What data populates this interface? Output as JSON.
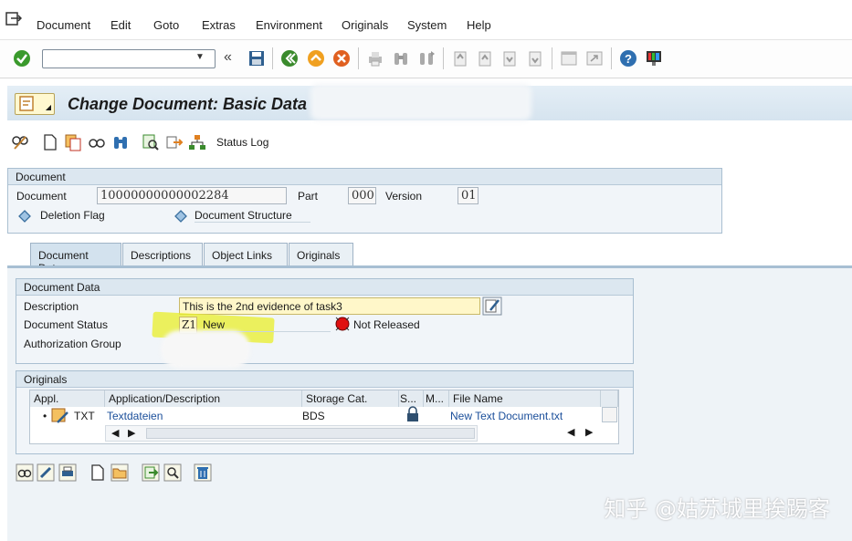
{
  "menu": {
    "items": [
      "Document",
      "Edit",
      "Goto",
      "Extras",
      "Environment",
      "Originals",
      "System",
      "Help"
    ]
  },
  "title": "Change Document: Basic Data",
  "app_toolbar": {
    "status_log_label": "Status Log"
  },
  "document_group": {
    "title": "Document",
    "document_label": "Document",
    "document_value": "10000000000002284",
    "part_label": "Part",
    "part_value": "000",
    "version_label": "Version",
    "version_value": "01",
    "deletion_flag_label": "Deletion Flag",
    "structure_label": "Document Structure"
  },
  "tabs": [
    "Document Data",
    "Descriptions",
    "Object Links",
    "Originals"
  ],
  "document_data": {
    "title": "Document Data",
    "description_label": "Description",
    "description_value": "This is the 2nd evidence of task3",
    "status_label": "Document Status",
    "status_code": "Z1",
    "status_text": "New",
    "release_text": "Not Released",
    "auth_group_label": "Authorization Group"
  },
  "originals": {
    "title": "Originals",
    "columns": [
      "Appl.",
      "Application/Description",
      "Storage Cat.",
      "S...",
      "M...",
      "File Name"
    ],
    "row": {
      "appl": "TXT",
      "description": "Textdateien",
      "storage": "BDS",
      "file_name": "New Text Document.txt"
    }
  },
  "watermark": "知乎 @姑苏城里挨踢客",
  "colors": {
    "title_bar": "#d6e4ef",
    "input_highlight": "#fff7c9",
    "marker_yellow": "#e8ee28",
    "status_red": "#e01010"
  }
}
